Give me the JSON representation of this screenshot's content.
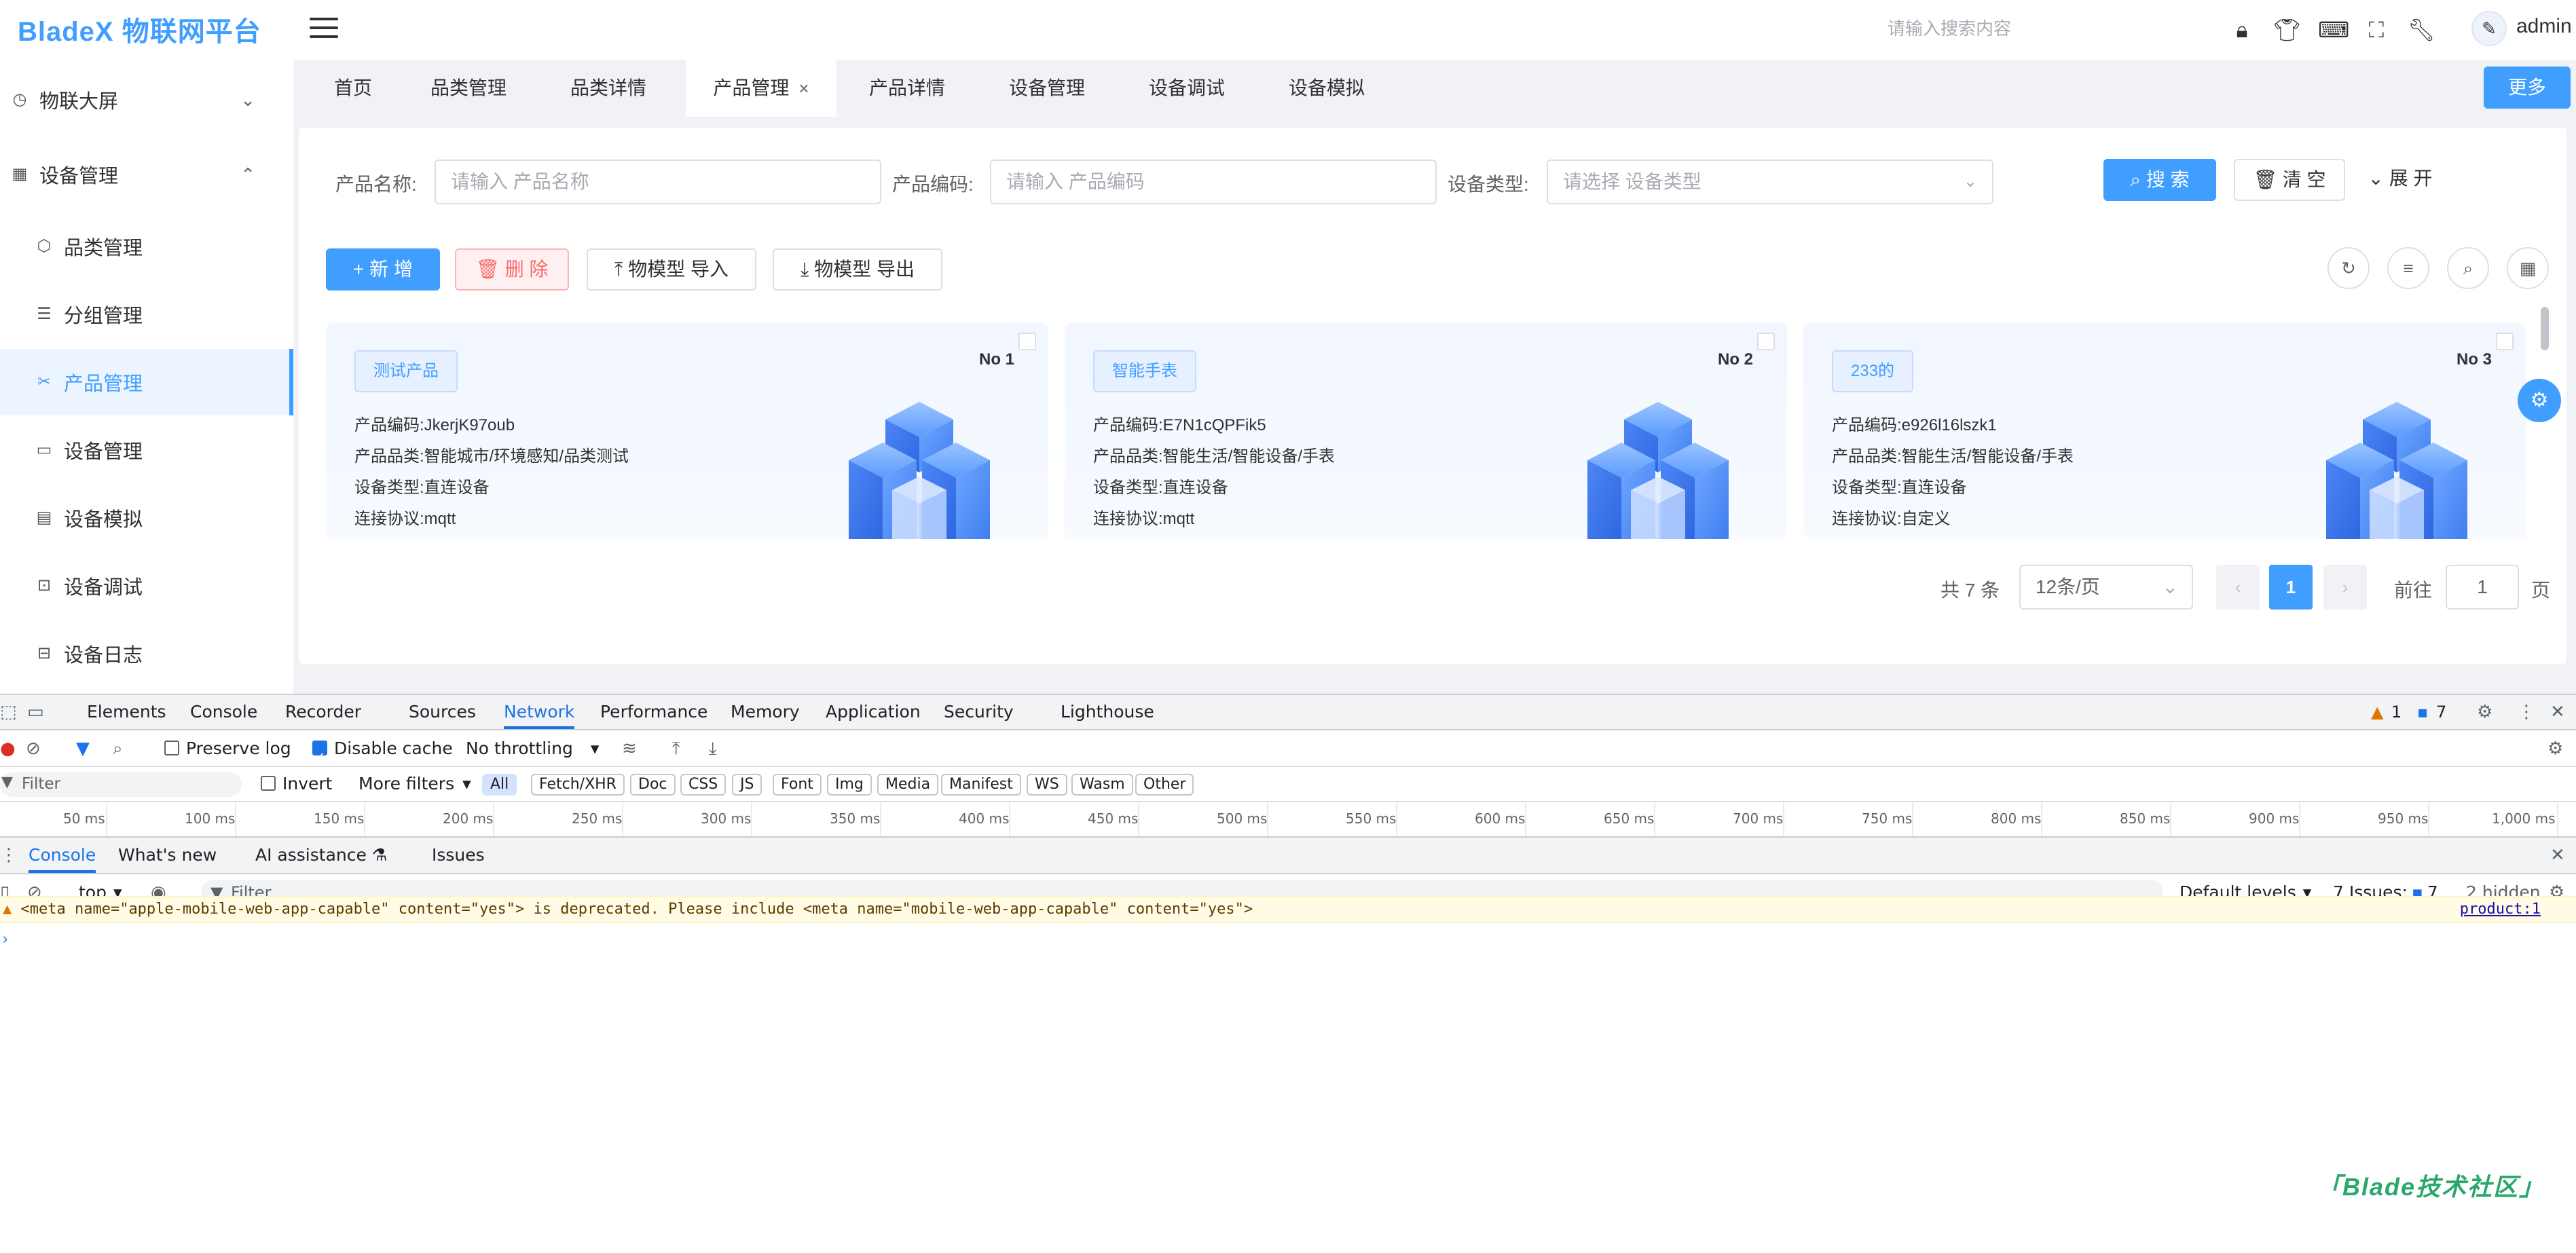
{
  "app": {
    "logo": "BladeX 物联网平台",
    "search_placeholder": "请输入搜索内容",
    "user": "admin",
    "top_icons": [
      "lock-icon",
      "shirt-icon",
      "translate-icon",
      "fullscreen-icon",
      "tool-icon"
    ]
  },
  "sidebar": {
    "groups": [
      {
        "label": "物联大屏",
        "icon": "dashboard-icon",
        "expanded": false
      },
      {
        "label": "设备管理",
        "icon": "device-group-icon",
        "expanded": true
      }
    ],
    "items": [
      {
        "label": "品类管理",
        "icon": "cube-icon"
      },
      {
        "label": "分组管理",
        "icon": "group-icon"
      },
      {
        "label": "产品管理",
        "icon": "product-icon",
        "active": true
      },
      {
        "label": "设备管理",
        "icon": "monitor-icon"
      },
      {
        "label": "设备模拟",
        "icon": "simulate-icon"
      },
      {
        "label": "设备调试",
        "icon": "debug-icon"
      },
      {
        "label": "设备日志",
        "icon": "log-icon"
      }
    ]
  },
  "tabs": [
    {
      "label": "首页"
    },
    {
      "label": "品类管理"
    },
    {
      "label": "品类详情"
    },
    {
      "label": "产品管理",
      "active": true,
      "close": "×"
    },
    {
      "label": "产品详情"
    },
    {
      "label": "设备管理"
    },
    {
      "label": "设备调试"
    },
    {
      "label": "设备模拟"
    }
  ],
  "more_label": "更多",
  "search_form": {
    "name_label": "产品名称:",
    "name_placeholder": "请输入 产品名称",
    "code_label": "产品编码:",
    "code_placeholder": "请输入 产品编码",
    "type_label": "设备类型:",
    "type_placeholder": "请选择 设备类型",
    "search_btn": "搜 索",
    "clear_btn": "清 空",
    "expand_btn": "展 开"
  },
  "toolbar": {
    "add": "新 增",
    "delete": "删 除",
    "import": "物模型 导入",
    "export": "物模型 导出"
  },
  "field_labels": {
    "code": "产品编码:",
    "category": "产品品类:",
    "device_type": "设备类型:",
    "protocol": "连接协议:"
  },
  "products": [
    {
      "name": "测试产品",
      "no": "No 1",
      "code": "JkerjK97oub",
      "category": "智能城市/环境感知/品类测试",
      "device_type": "直连设备",
      "protocol": "mqtt"
    },
    {
      "name": "智能手表",
      "no": "No 2",
      "code": "E7N1cQPFik5",
      "category": "智能生活/智能设备/手表",
      "device_type": "直连设备",
      "protocol": "mqtt"
    },
    {
      "name": "233的",
      "no": "No 3",
      "code": "e926l16lszk1",
      "category": "智能生活/智能设备/手表",
      "device_type": "直连设备",
      "protocol": "自定义"
    }
  ],
  "pagination": {
    "total": "共 7 条",
    "page_size": "12条/页",
    "current": "1",
    "goto_label": "前往",
    "goto_value": "1",
    "page_suffix": "页"
  },
  "devtools": {
    "tabs": [
      "Elements",
      "Console",
      "Recorder",
      "Sources",
      "Network",
      "Performance",
      "Memory",
      "Application",
      "Security",
      "Lighthouse"
    ],
    "active_tab": "Network",
    "warn_count": "1",
    "issue_count": "7",
    "preserve_log": "Preserve log",
    "disable_cache": "Disable cache",
    "throttling": "No throttling",
    "filter_placeholder": "Filter",
    "invert": "Invert",
    "more_filters": "More filters",
    "chips": [
      "All",
      "Fetch/XHR",
      "Doc",
      "CSS",
      "JS",
      "Font",
      "Img",
      "Media",
      "Manifest",
      "WS",
      "Wasm",
      "Other"
    ],
    "timeline": [
      "50 ms",
      "100 ms",
      "150 ms",
      "200 ms",
      "250 ms",
      "300 ms",
      "350 ms",
      "400 ms",
      "450 ms",
      "500 ms",
      "550 ms",
      "600 ms",
      "650 ms",
      "700 ms",
      "750 ms",
      "800 ms",
      "850 ms",
      "900 ms",
      "950 ms",
      "1,000 ms"
    ],
    "drawer_tabs": [
      "Console",
      "What's new",
      "AI assistance",
      "Issues"
    ],
    "context": "top",
    "console_filter": "Filter",
    "levels": "Default levels",
    "issues_label": "7 Issues:",
    "issues_count": "7",
    "hidden": "2 hidden",
    "warning_message": "<meta name=\"apple-mobile-web-app-capable\" content=\"yes\"> is deprecated. Please include <meta name=\"mobile-web-app-capable\" content=\"yes\">",
    "warning_source": "product:1"
  },
  "watermark": "Blade技术社区"
}
